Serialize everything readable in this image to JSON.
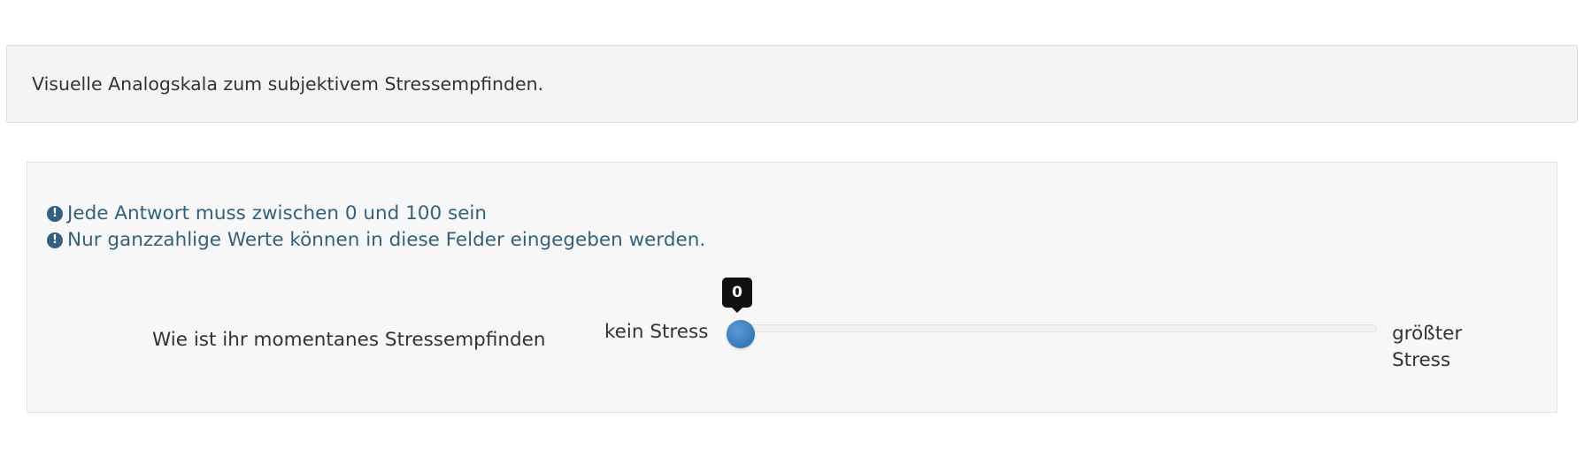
{
  "description": {
    "text": "Visuelle Analogskala zum subjektivem Stressempfinden."
  },
  "question": {
    "hints": [
      "Jede Antwort muss zwischen 0 und 100 sein",
      "Nur ganzzahlige Werte können in diese Felder eingegeben werden."
    ],
    "hint_icon": "exclamation-circle-icon",
    "label": "Wie ist ihr momentanes Stressempfinden",
    "slider": {
      "left_label": "kein Stress",
      "right_label": "größter Stress",
      "value": "0",
      "min": 0,
      "max": 100,
      "handle_color": "#337ab7"
    }
  },
  "colors": {
    "hint_text": "#32617e",
    "tooltip_bg": "#111111"
  }
}
